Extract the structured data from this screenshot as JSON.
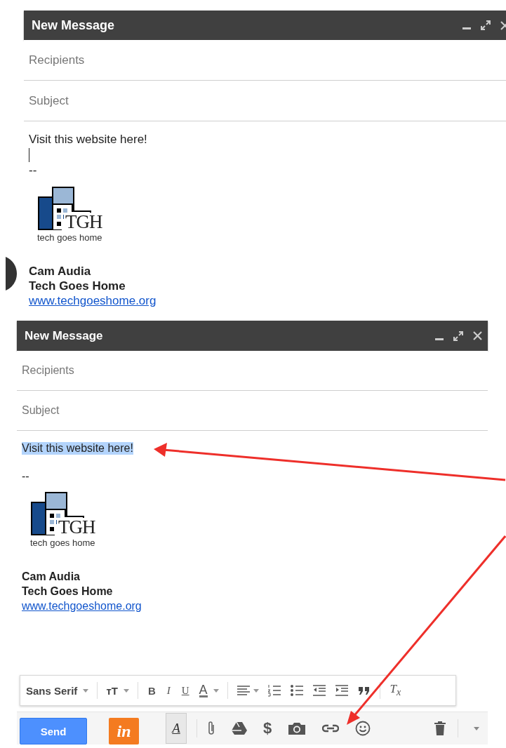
{
  "composes": [
    {
      "title": "New Message",
      "recipients_placeholder": "Recipients",
      "subject_placeholder": "Subject",
      "body_text": "Visit this website here!",
      "body_selected": false,
      "caret": true,
      "separator": "--",
      "logo_text": "TGH",
      "logo_tagline": "tech goes home",
      "signature_name": "Cam Audia",
      "signature_org": "Tech Goes Home",
      "signature_link": "www.techgoeshome.org"
    },
    {
      "title": "New Message",
      "recipients_placeholder": "Recipients",
      "subject_placeholder": "Subject",
      "body_text": "Visit this website here!",
      "body_selected": true,
      "caret": false,
      "separator": "--",
      "logo_text": "TGH",
      "logo_tagline": "tech goes home",
      "signature_name": "Cam Audia",
      "signature_org": "Tech Goes Home",
      "signature_link": "www.techgoeshome.org"
    }
  ],
  "format_toolbar": {
    "font": "Sans Serif",
    "font_size": "ᴛT",
    "bold": "B",
    "italic": "I",
    "underline": "U",
    "text_color": "A",
    "clear_formatting": "T$_{x}$"
  },
  "bottom_bar": {
    "send": "Send",
    "app_logo": "in",
    "format_button": "A",
    "money": "$"
  }
}
